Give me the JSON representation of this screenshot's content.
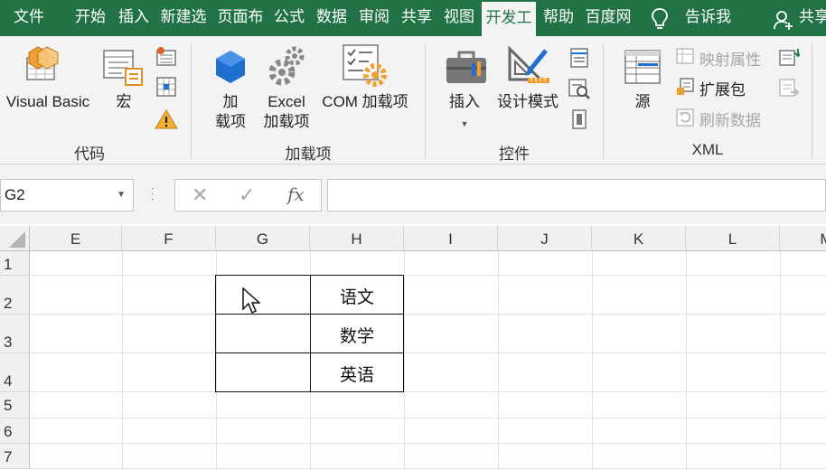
{
  "tabs": [
    {
      "label": "文件"
    },
    {
      "label": "开始"
    },
    {
      "label": "插入"
    },
    {
      "label": "新建选"
    },
    {
      "label": "页面布"
    },
    {
      "label": "公式"
    },
    {
      "label": "数据"
    },
    {
      "label": "审阅"
    },
    {
      "label": "共享"
    },
    {
      "label": "视图"
    },
    {
      "label": "开发工"
    },
    {
      "label": "帮助"
    },
    {
      "label": "百度网"
    }
  ],
  "active_tab": "开发工",
  "tell_me": "告诉我",
  "share": "共享",
  "ribbon": {
    "code": {
      "group_label": "代码",
      "visual_basic": "Visual Basic",
      "macros": "宏"
    },
    "addins": {
      "group_label": "加载项",
      "addins_line1": "加",
      "addins_line2": "载项",
      "excel_addins_line1": "Excel",
      "excel_addins_line2": "加载项",
      "com_addins": "COM 加载项"
    },
    "controls": {
      "group_label": "控件",
      "insert": "插入",
      "design_mode": "设计模式"
    },
    "xml": {
      "group_label": "XML",
      "source": "源",
      "map_properties": "映射属性",
      "expansion_packs": "扩展包",
      "refresh_data": "刷新数据"
    }
  },
  "name_box": "G2",
  "formula_buttons": {
    "cancel": "✕",
    "enter": "✓",
    "fx": "fx"
  },
  "formula_value": "",
  "columns": [
    "E",
    "F",
    "G",
    "H",
    "I",
    "J",
    "K",
    "L",
    "M"
  ],
  "rows": [
    "1",
    "2",
    "3",
    "4",
    "5",
    "6",
    "7"
  ],
  "cells": {
    "H2": "语文",
    "H3": "数学",
    "H4": "英语"
  },
  "colors": {
    "accent": "#217346",
    "ribbon_bg": "#f3f3f3",
    "icon_orange": "#f0a030",
    "icon_blue": "#1e6fd0"
  }
}
